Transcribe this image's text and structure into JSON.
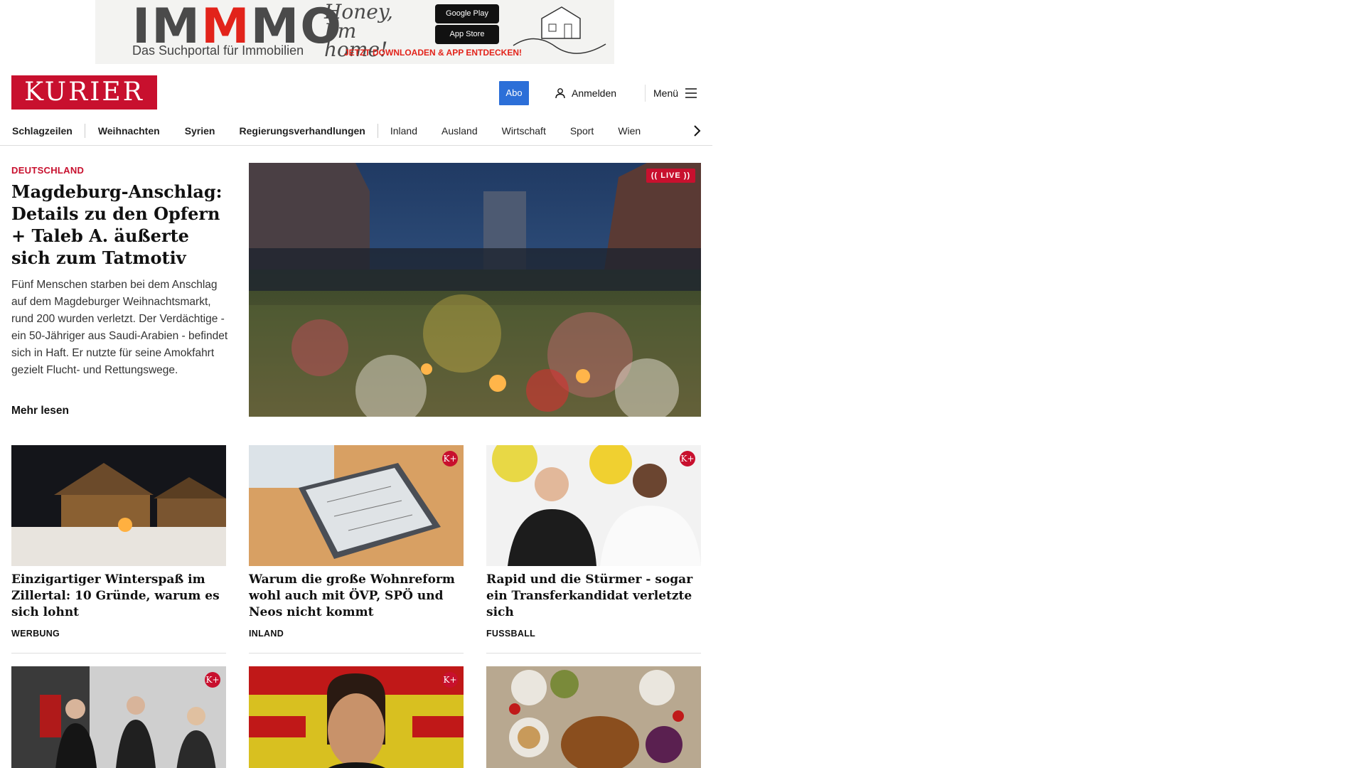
{
  "ad": {
    "brand_prefix": "IM",
    "brand_mid": "M",
    "brand_suffix": "MO",
    "tagline": "Das Suchportal für Immobilien",
    "script": "Honey, I'm home!",
    "google_play": "Google Play",
    "app_store": "App Store",
    "cta": "JETZT DOWNLOADEN & APP ENTDECKEN!"
  },
  "header": {
    "logo": "KURIER",
    "abo": "Abo",
    "login": "Anmelden",
    "menu": "Menü"
  },
  "nav": {
    "items": [
      "Schlagzeilen",
      "Weihnachten",
      "Syrien",
      "Regierungsverhandlungen",
      "Inland",
      "Ausland",
      "Wirtschaft",
      "Sport",
      "Wien"
    ]
  },
  "lead": {
    "kicker": "DEUTSCHLAND",
    "title": "Magdeburg-Anschlag: Details zu den Opfern + Taleb A. äußerte sich zum Tatmotiv",
    "text": "Fünf Menschen starben bei dem Anschlag auf dem Magdeburger Weihnachtsmarkt, rund 200 wurden verletzt. Der Verdächtige - ein 50-Jähriger aus Saudi-Arabien - befindet sich in Haft. Er nutzte für seine Amokfahrt gezielt Flucht- und Rettungswege.",
    "more": "Mehr lesen",
    "live": "LIVE"
  },
  "cards": [
    {
      "title": "Einzigartiger Winterspaß im Zillertal: 10 Gründe, warum es sich lohnt",
      "category": "WERBUNG"
    },
    {
      "title": "Warum die große Wohnreform wohl auch mit ÖVP, SPÖ und Neos nicht kommt",
      "category": "INLAND",
      "badge": "K+"
    },
    {
      "title": "Rapid und die Stürmer - sogar ein Transferkandidat verletzte sich",
      "category": "FUSSBALL",
      "badge": "K+"
    },
    {
      "badge": "K+"
    },
    {
      "badge": "K+"
    },
    {}
  ],
  "colors": {
    "brand_red": "#c8102e",
    "abo_blue": "#2c6fd8"
  }
}
